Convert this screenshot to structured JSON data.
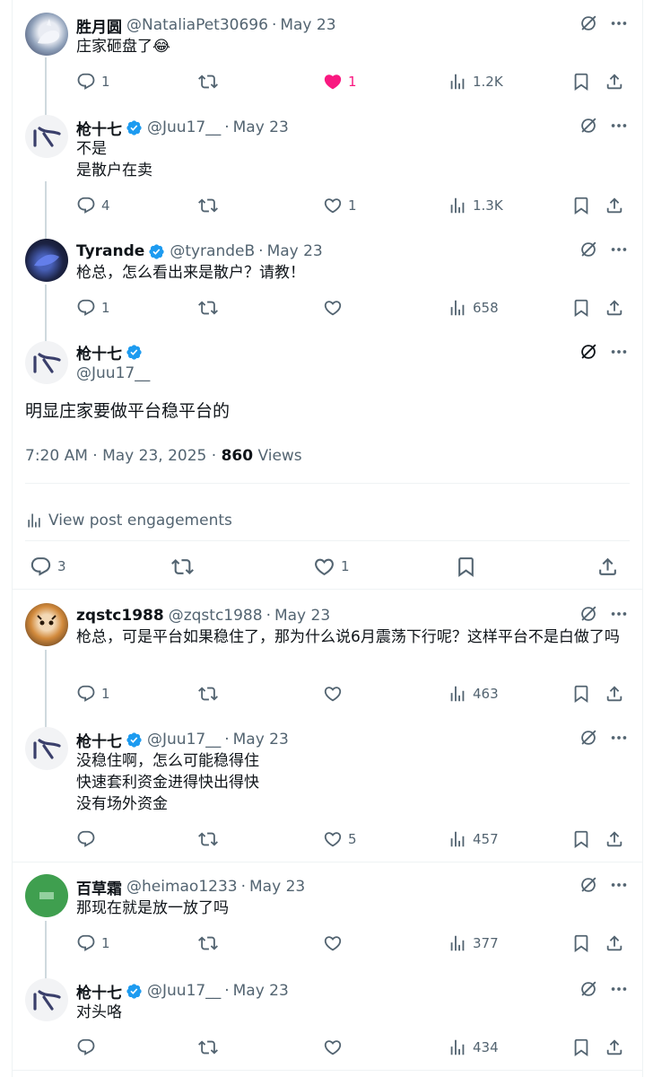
{
  "colors": {
    "text": "#0f1419",
    "muted": "#536471",
    "like": "#f91880",
    "verified": "#1d9bf0",
    "border": "#eff3f4",
    "thread": "#cfd9de"
  },
  "tweets": [
    {
      "name": "胜月圆",
      "handle": "@NataliaPet30696",
      "date": "May 23",
      "text": "庄家砸盘了😂",
      "replies": "1",
      "retweets": "",
      "likes": "1",
      "views": "1.2K",
      "verified": false,
      "avatar": "cat",
      "liked": true
    },
    {
      "name": "枪十七",
      "handle": "@Juu17__",
      "date": "May 23",
      "text": "不是\n是散户在卖",
      "replies": "4",
      "retweets": "",
      "likes": "1",
      "views": "1.3K",
      "verified": true,
      "avatar": "logo"
    },
    {
      "name": "Tyrande",
      "handle": "@tyrandeB",
      "date": "May 23",
      "text": "枪总，怎么看出来是散户？请教！",
      "replies": "1",
      "retweets": "",
      "likes": "",
      "views": "658",
      "verified": true,
      "avatar": "dark"
    }
  ],
  "main": {
    "name": "枪十七",
    "handle": "@Juu17__",
    "text": "明显庄家要做平台稳平台的",
    "time": "7:20 AM · May 23, 2025 · ",
    "views_count": "860",
    "views_label": " Views",
    "engagements": "View post engagements",
    "replies": "3",
    "retweets": "",
    "likes": "1"
  },
  "replies": [
    {
      "name": "zqstc1988",
      "handle": "@zqstc1988",
      "date": "May 23",
      "text": "枪总，可是平台如果稳住了，那为什么说6月震荡下行呢？这样平台不是白做了吗",
      "replies": "1",
      "retweets": "",
      "likes": "",
      "views": "463",
      "verified": false,
      "avatar": "tiger"
    },
    {
      "name": "枪十七",
      "handle": "@Juu17__",
      "date": "May 23",
      "text": "没稳住啊，怎么可能稳得住\n快速套利资金进得快出得快\n没有场外资金",
      "replies": "",
      "retweets": "",
      "likes": "5",
      "views": "457",
      "verified": true,
      "avatar": "logo"
    },
    {
      "name": "百草霜",
      "handle": "@heimao1233",
      "date": "May 23",
      "text": "那现在就是放一放了吗",
      "replies": "1",
      "retweets": "",
      "likes": "",
      "views": "377",
      "verified": false,
      "avatar": "green"
    },
    {
      "name": "枪十七",
      "handle": "@Juu17__",
      "date": "May 23",
      "text": "对头咯",
      "replies": "",
      "retweets": "",
      "likes": "",
      "views": "434",
      "verified": true,
      "avatar": "logo"
    }
  ]
}
